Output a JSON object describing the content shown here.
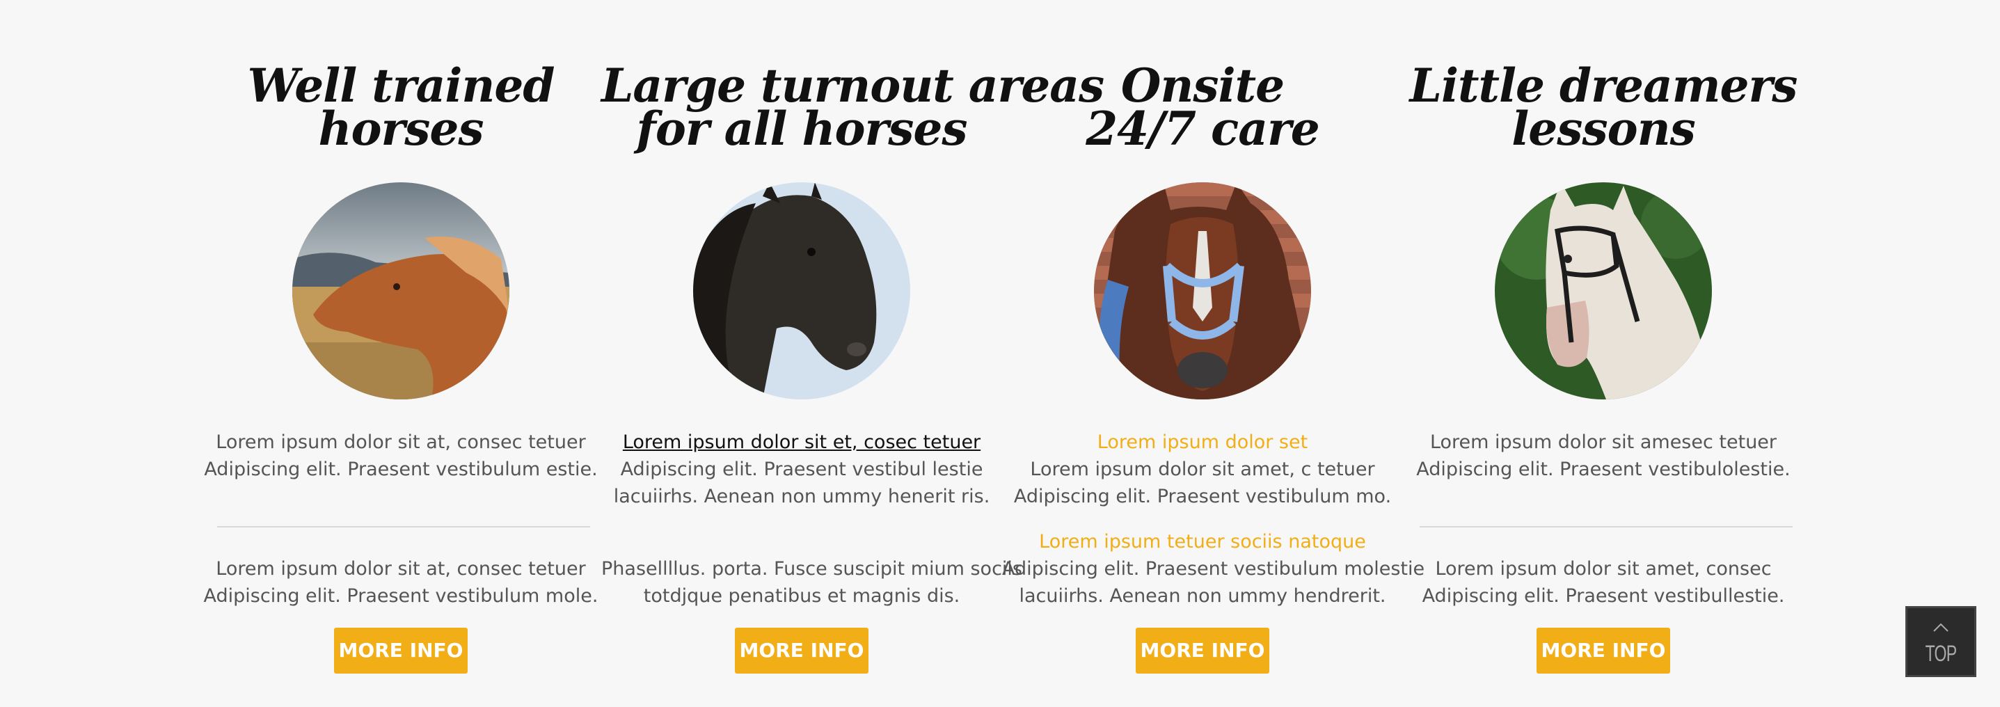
{
  "colors": {
    "background": "#f7f7f7",
    "accent": "#f2ae17",
    "text": "#555555",
    "title": "#111111",
    "divider": "#d9d9d9"
  },
  "columns": [
    {
      "title_line1": "Well trained",
      "title_line2": "horses",
      "image_icon": "horse-photo-chestnut",
      "block1": [
        "Lorem ipsum dolor sit at, consec tetuer",
        "Adipiscing elit. Praesent vestibulum estie."
      ],
      "block2": [
        "Lorem ipsum dolor sit at, consec tetuer",
        "Adipiscing elit. Praesent vestibulum mole."
      ],
      "button": "MORE INFO"
    },
    {
      "title_line1": "Large turnout areas",
      "title_line2": "for all horses",
      "image_icon": "horse-photo-black",
      "link": "Lorem ipsum dolor sit et, cosec tetuer",
      "block1": [
        "Adipiscing elit. Praesent vestibul lestie",
        "lacuiirhs. Aenean non ummy henerit ris."
      ],
      "block2": [
        "Phasellllus. porta. Fusce suscipit mium sociis",
        "totdjque penatibus et magnis dis."
      ],
      "button": "MORE INFO"
    },
    {
      "title_line1": "Onsite",
      "title_line2": "24/7 care",
      "image_icon": "horse-photo-bay-halter",
      "heading1": "Lorem ipsum dolor set",
      "block1": [
        "Lorem ipsum dolor sit amet, c tetuer",
        "Adipiscing elit. Praesent vestibulum mo."
      ],
      "heading2": "Lorem ipsum tetuer sociis natoque",
      "block2": [
        "Adipiscing elit. Praesent vestibulum molestie",
        "lacuiirhs. Aenean non ummy hendrerit."
      ],
      "button": "MORE INFO"
    },
    {
      "title_line1": "Little dreamers",
      "title_line2": "lessons",
      "image_icon": "horse-photo-white",
      "block1": [
        "Lorem ipsum dolor sit amesec tetuer",
        "Adipiscing elit. Praesent vestibulolestie."
      ],
      "block2": [
        "Lorem ipsum dolor sit amet, consec",
        "Adipiscing elit. Praesent vestibullestie."
      ],
      "button": "MORE INFO"
    }
  ],
  "back_to_top": {
    "label": "TOP",
    "icon": "chevron-up-icon"
  }
}
